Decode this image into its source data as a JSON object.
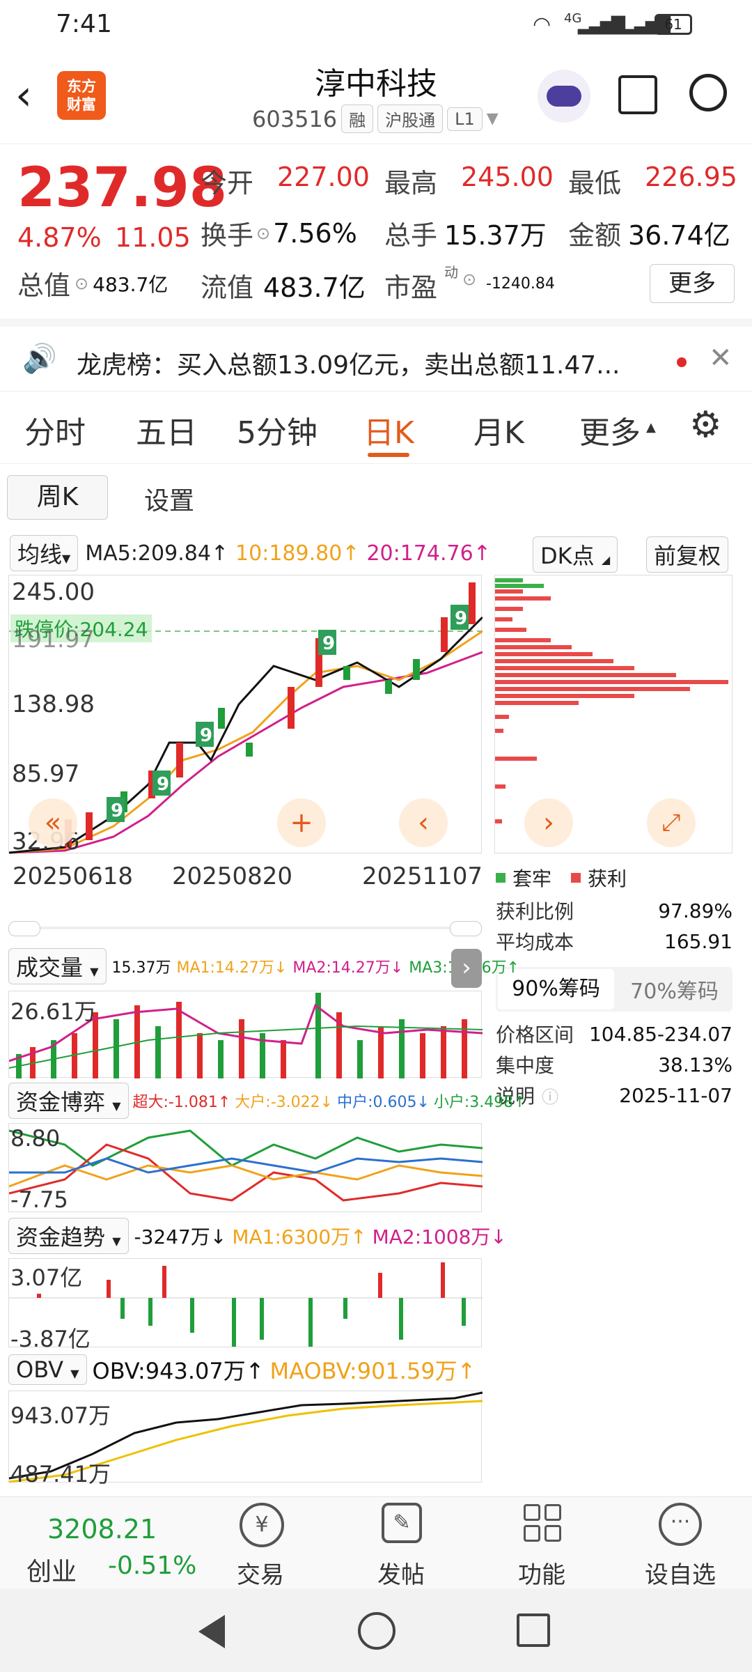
{
  "status_bar": {
    "time": "7:41",
    "signal_text": "4G",
    "battery": "61"
  },
  "header": {
    "logo_text": "东方财富",
    "title": "淳中科技",
    "code": "603516",
    "tags": [
      "融",
      "沪股通",
      "L1"
    ]
  },
  "quote": {
    "price": "237.98",
    "change_pct": "4.87%",
    "change_abs": "11.05",
    "open_label": "今开",
    "open": "227.00",
    "high_label": "最高",
    "high": "245.00",
    "low_label": "最低",
    "low": "226.95",
    "turnover_label": "换手",
    "turnover": "7.56%",
    "volume_label": "总手",
    "volume": "15.37万",
    "amount_label": "金额",
    "amount": "36.74亿",
    "mktcap_label": "总值",
    "mktcap": "483.7亿",
    "float_label": "流值",
    "float_cap": "483.7亿",
    "pe_label": "市盈",
    "pe_sup": "动",
    "pe": "-1240.84",
    "more_button": "更多"
  },
  "notice": {
    "text": "龙虎榜：买入总额13.09亿元，卖出总额11.47..."
  },
  "tabs": [
    "分时",
    "五日",
    "5分钟",
    "日K",
    "月K",
    "更多"
  ],
  "active_tab": "日K",
  "subtabs": [
    "周K",
    "设置"
  ],
  "ma_bar": {
    "label": "均线",
    "ma5": "MA5:209.84↑",
    "ma10": "10:189.80↑",
    "ma20": "20:174.76↑",
    "dk_button": "DK点",
    "adjust_button": "前复权"
  },
  "kline": {
    "y_labels": [
      "245.00",
      "191.97",
      "138.98",
      "85.97",
      "32.96"
    ],
    "limit_label": "跌停价:204.24",
    "x_labels": [
      "20250618",
      "20250820",
      "20251107"
    ]
  },
  "chip_panel": {
    "legend_trapped": "套牢",
    "legend_profit": "获利",
    "stats": [
      {
        "label": "获利比例",
        "value": "97.89%"
      },
      {
        "label": "平均成本",
        "value": "165.91"
      }
    ],
    "tabs": [
      "90%筹码",
      "70%筹码"
    ],
    "stats2": [
      {
        "label": "价格区间",
        "value": "104.85-234.07"
      },
      {
        "label": "集中度",
        "value": "38.13%"
      },
      {
        "label": "说明",
        "value": "2025-11-07"
      }
    ]
  },
  "volume": {
    "label": "成交量",
    "v": "15.37万",
    "ma1": "MA1:14.27万↓",
    "ma2": "MA2:14.27万↓",
    "ma3": "MA3:13.66万↑",
    "y_label": "26.61万"
  },
  "fund_game": {
    "label": "资金博弈",
    "super": "超大:-1.081↑",
    "big": "大户:-3.022↓",
    "mid": "中户:0.605↓",
    "small": "小户:3.498↑",
    "y_top": "8.80",
    "y_bottom": "-7.75"
  },
  "fund_trend": {
    "label": "资金趋势",
    "v": "-3247万↓",
    "ma1": "MA1:6300万↑",
    "ma2": "MA2:1008万↓",
    "y_top": "3.07亿",
    "y_bottom": "-3.87亿"
  },
  "obv": {
    "label": "OBV",
    "v": "OBV:943.07万↑",
    "maobv": "MAOBV:901.59万↑",
    "y_top": "943.07万",
    "y_bottom": "487.41万"
  },
  "bottom_nav": {
    "index_value": "3208.21",
    "index_name": "创业",
    "index_change": "-0.51%",
    "items": [
      "交易",
      "发帖",
      "功能",
      "设自选"
    ]
  },
  "colors": {
    "accent": "#e25b1d",
    "up": "#e02a2a",
    "down": "#1f9e3a"
  }
}
